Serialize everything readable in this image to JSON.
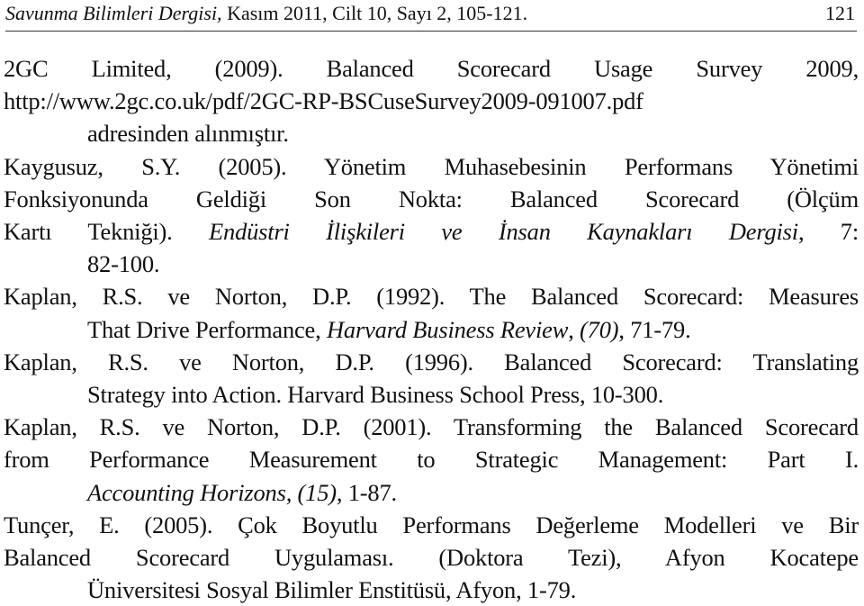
{
  "header": {
    "journal_italic": "Savunma Bilimleri Dergisi,",
    "journal_rest": " Kasım 2011, Cilt 10, Sayı 2, 105-121.",
    "page_number": "121"
  },
  "references": [
    {
      "lines": [
        {
          "parts": [
            {
              "t": "2GC Limited, (2009). Balanced Scorecard Usage Survey 2009,"
            }
          ],
          "justify": true
        },
        {
          "parts": [
            {
              "t": "http://www.2gc.co.uk/pdf/2GC-RP-BSCuseSurvey2009-091007.pdf"
            }
          ],
          "justify": true
        },
        {
          "parts": [
            {
              "t": "adresinden alınmıştır."
            }
          ],
          "justify": false
        }
      ]
    },
    {
      "lines": [
        {
          "parts": [
            {
              "t": "Kaygusuz, S.Y. (2005). Yönetim Muhasebesinin Performans Yönetimi"
            }
          ],
          "justify": true
        },
        {
          "parts": [
            {
              "t": "Fonksiyonunda Geldiği Son Nokta: Balanced Scorecard (Ölçüm"
            }
          ],
          "justify": true
        },
        {
          "parts": [
            {
              "t": "Kartı Tekniği). "
            },
            {
              "t": "Endüstri İlişkileri ve İnsan Kaynakları Dergisi",
              "i": true
            },
            {
              "t": ", 7:"
            }
          ],
          "justify": true
        },
        {
          "parts": [
            {
              "t": "82-100."
            }
          ],
          "justify": false
        }
      ]
    },
    {
      "lines": [
        {
          "parts": [
            {
              "t": "Kaplan, R.S. ve Norton, D.P. (1992). The Balanced Scorecard: Measures"
            }
          ],
          "justify": true
        },
        {
          "parts": [
            {
              "t": "That Drive Performance, "
            },
            {
              "t": "Harvard Business Review",
              "i": true
            },
            {
              "t": ", "
            },
            {
              "t": "(70)",
              "i": true
            },
            {
              "t": ", 71-79."
            }
          ],
          "justify": false
        }
      ]
    },
    {
      "lines": [
        {
          "parts": [
            {
              "t": "Kaplan, R.S. ve Norton, D.P. (1996). Balanced Scorecard: Translating"
            }
          ],
          "justify": true
        },
        {
          "parts": [
            {
              "t": "Strategy into Action. Harvard Business School Press, 10-300."
            }
          ],
          "justify": false
        }
      ]
    },
    {
      "lines": [
        {
          "parts": [
            {
              "t": "Kaplan, R.S. ve Norton, D.P. (2001). Transforming the Balanced Scorecard"
            }
          ],
          "justify": true
        },
        {
          "parts": [
            {
              "t": "from Performance Measurement to Strategic Management: Part I."
            }
          ],
          "justify": true
        },
        {
          "parts": [
            {
              "t": "Accounting Horizons, (15)",
              "i": true
            },
            {
              "t": ", 1-87."
            }
          ],
          "justify": false
        }
      ]
    },
    {
      "lines": [
        {
          "parts": [
            {
              "t": "Tunçer, E. (2005). Çok Boyutlu Performans Değerleme Modelleri ve Bir"
            }
          ],
          "justify": true
        },
        {
          "parts": [
            {
              "t": "Balanced Scorecard Uygulaması. (Doktora Tezi), Afyon Kocatepe"
            }
          ],
          "justify": true
        },
        {
          "parts": [
            {
              "t": "Üniversitesi Sosyal Bilimler Enstitüsü, Afyon, 1-79."
            }
          ],
          "justify": false
        }
      ]
    }
  ]
}
